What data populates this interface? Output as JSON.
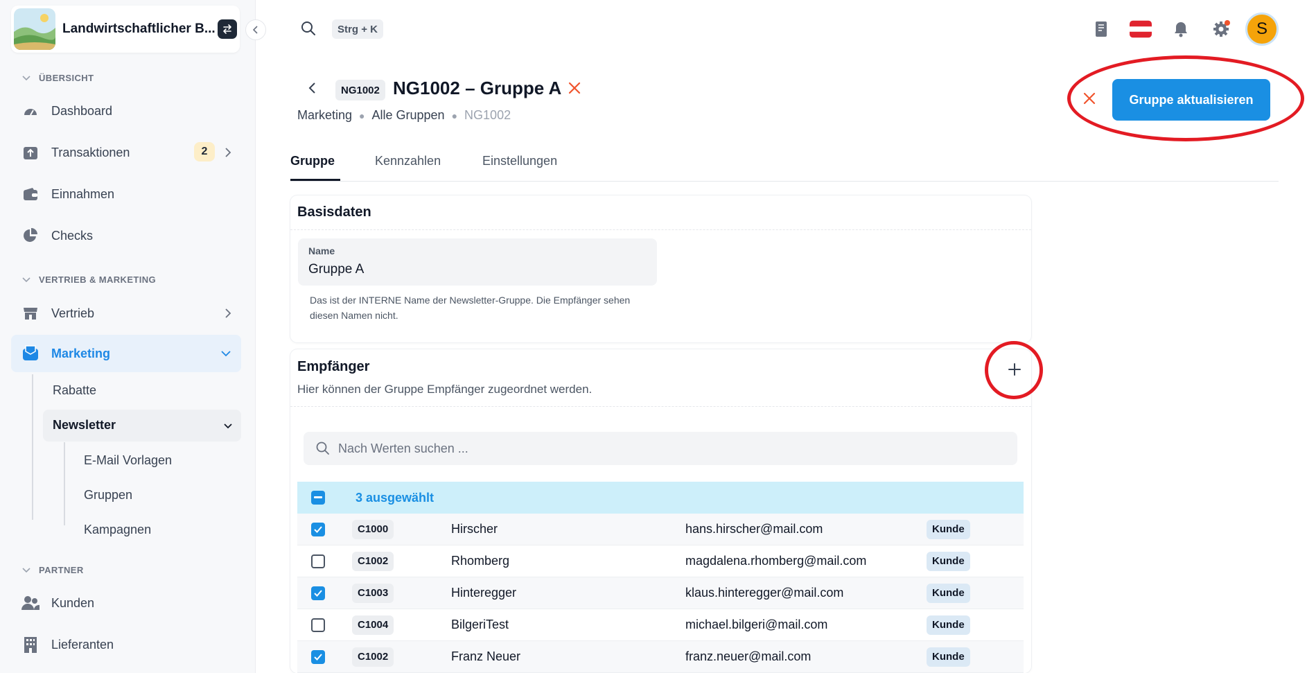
{
  "sidebar": {
    "brand": "Landwirtschaftlicher B...",
    "sections": {
      "overview": "ÜBERSICHT",
      "sales": "VERTRIEB & MARKETING",
      "partner": "PARTNER"
    },
    "items": {
      "dashboard": "Dashboard",
      "transactions": "Transaktionen",
      "transactions_count": "2",
      "income": "Einnahmen",
      "checks": "Checks",
      "sales": "Vertrieb",
      "marketing": "Marketing",
      "discounts": "Rabatte",
      "newsletter": "Newsletter",
      "email_templates": "E-Mail Vorlagen",
      "groups": "Gruppen",
      "campaigns": "Kampagnen",
      "customers": "Kunden",
      "suppliers": "Lieferanten"
    }
  },
  "topbar": {
    "shortcut": "Strg + K",
    "avatar_initial": "S"
  },
  "header": {
    "code": "NG1002",
    "title": "NG1002 – Gruppe A",
    "breadcrumb": [
      "Marketing",
      "Alle Gruppen",
      "NG1002"
    ],
    "primary_button": "Gruppe aktualisieren"
  },
  "tabs": [
    "Gruppe",
    "Kennzahlen",
    "Einstellungen"
  ],
  "basisdaten": {
    "title": "Basisdaten",
    "name_label": "Name",
    "name_value": "Gruppe A",
    "helper": "Das ist der INTERNE Name der Newsletter-Gruppe. Die Empfänger sehen diesen Namen nicht."
  },
  "empfaenger": {
    "title": "Empfänger",
    "description": "Hier können der Gruppe Empfänger zugeordnet werden.",
    "search_placeholder": "Nach Werten suchen ...",
    "selected_text": "3 ausgewählt",
    "rows": [
      {
        "code": "C1000",
        "name": "Hirscher",
        "email": "hans.hirscher@mail.com",
        "type": "Kunde",
        "checked": true
      },
      {
        "code": "C1002",
        "name": "Rhomberg",
        "email": "magdalena.rhomberg@mail.com",
        "type": "Kunde",
        "checked": false
      },
      {
        "code": "C1003",
        "name": "Hinteregger",
        "email": "klaus.hinteregger@mail.com",
        "type": "Kunde",
        "checked": true
      },
      {
        "code": "C1004",
        "name": "BilgeriTest",
        "email": "michael.bilgeri@mail.com",
        "type": "Kunde",
        "checked": false
      },
      {
        "code": "C1002",
        "name": "Franz Neuer",
        "email": "franz.neuer@mail.com",
        "type": "Kunde",
        "checked": true
      }
    ]
  },
  "colors": {
    "primary": "#1a8fe3",
    "annotation": "#e31b23",
    "selection_bar": "#cdeffa"
  }
}
